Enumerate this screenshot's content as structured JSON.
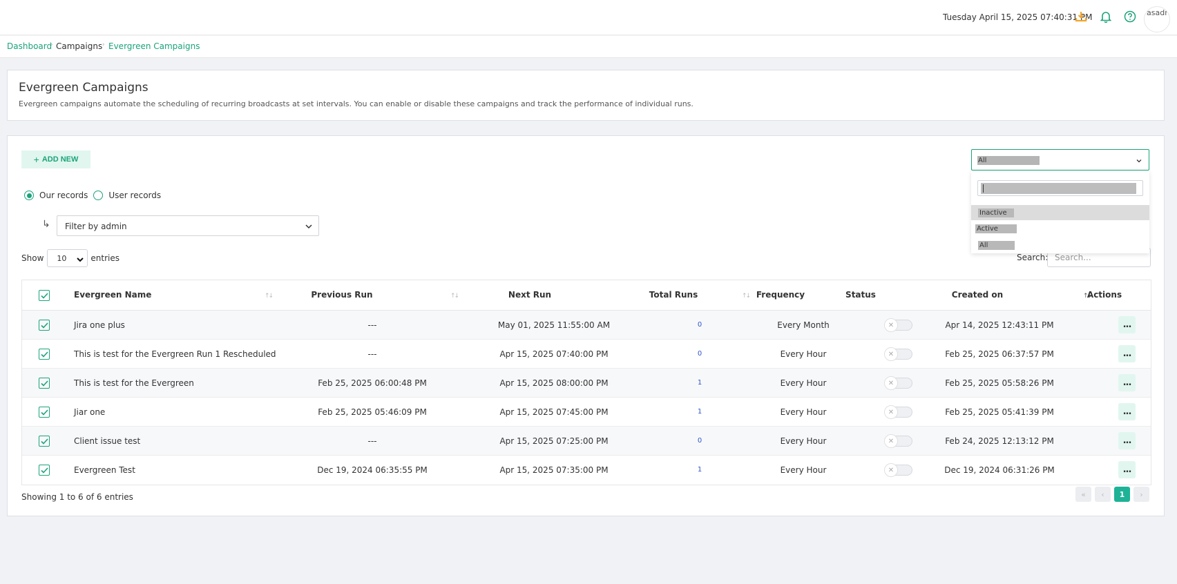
{
  "header": {
    "datetime": "Tuesday April 15, 2025 07:40:31 PM",
    "avatar_alt": "asadro",
    "icons": [
      "download-icon",
      "bell-icon",
      "help-icon"
    ],
    "accent_color": "#f2a52a"
  },
  "breadcrumb": {
    "items": [
      "Dashboard",
      "Campaigns",
      "Evergreen Campaigns"
    ]
  },
  "intro": {
    "title": "Evergreen Campaigns",
    "description": "Evergreen campaigns automate the scheduling of recurring broadcasts at set intervals. You can enable or disable these campaigns and track the performance of individual runs."
  },
  "toolbar": {
    "add_new": "ADD NEW",
    "radio_our": "Our records",
    "radio_user": "User records",
    "radio_selected": "Our records",
    "filter_admin": "Filter by admin",
    "show_label": "Show",
    "entries_value": "10",
    "entries_label": "entries",
    "search_label": "Search:",
    "search_placeholder": "Search..."
  },
  "status_filter": {
    "selected": "All",
    "options": [
      "Inactive",
      "Active",
      "All"
    ],
    "hovered": "Inactive"
  },
  "table": {
    "columns": [
      "Evergreen Name",
      "Previous Run",
      "Next Run",
      "Total Runs",
      "Frequency",
      "Status",
      "Created on",
      "Actions"
    ],
    "rows": [
      {
        "name": "Jira one plus",
        "previous": "---",
        "next": "May 01, 2025 11:55:00 AM",
        "runs": "0",
        "frequency": "Every Month",
        "created": "Apr 14, 2025 12:43:11 PM",
        "actions": "..."
      },
      {
        "name": "This is test for the Evergreen Run 1 Rescheduled",
        "previous": "---",
        "next": "Apr 15, 2025 07:40:00 PM",
        "runs": "0",
        "frequency": "Every Hour",
        "created": "Feb 25, 2025 06:37:57 PM",
        "actions": "..."
      },
      {
        "name": "This is test for the Evergreen",
        "previous": "Feb 25, 2025 06:00:48 PM",
        "next": "Apr 15, 2025 08:00:00 PM",
        "runs": "1",
        "frequency": "Every Hour",
        "created": "Feb 25, 2025 05:58:26 PM",
        "actions": "..."
      },
      {
        "name": "Jiar one",
        "previous": "Feb 25, 2025 05:46:09 PM",
        "next": "Apr 15, 2025 07:45:00 PM",
        "runs": "1",
        "frequency": "Every Hour",
        "created": "Feb 25, 2025 05:41:39 PM",
        "actions": "..."
      },
      {
        "name": "Client issue test",
        "previous": "---",
        "next": "Apr 15, 2025 07:25:00 PM",
        "runs": "0",
        "frequency": "Every Hour",
        "created": "Feb 24, 2025 12:13:12 PM",
        "actions": "..."
      },
      {
        "name": "Evergreen Test",
        "previous": "Dec 19, 2024 06:35:55 PM",
        "next": "Apr 15, 2025 07:35:00 PM",
        "runs": "1",
        "frequency": "Every Hour",
        "created": "Dec 19, 2024 06:31:26 PM",
        "actions": "..."
      }
    ]
  },
  "footer": {
    "showing": "Showing 1 to 6 of 6 entries",
    "page": "1"
  },
  "colors": {
    "accent": "#1aa37a",
    "page_active": "#1eb397",
    "runs_link": "#3153c9"
  }
}
